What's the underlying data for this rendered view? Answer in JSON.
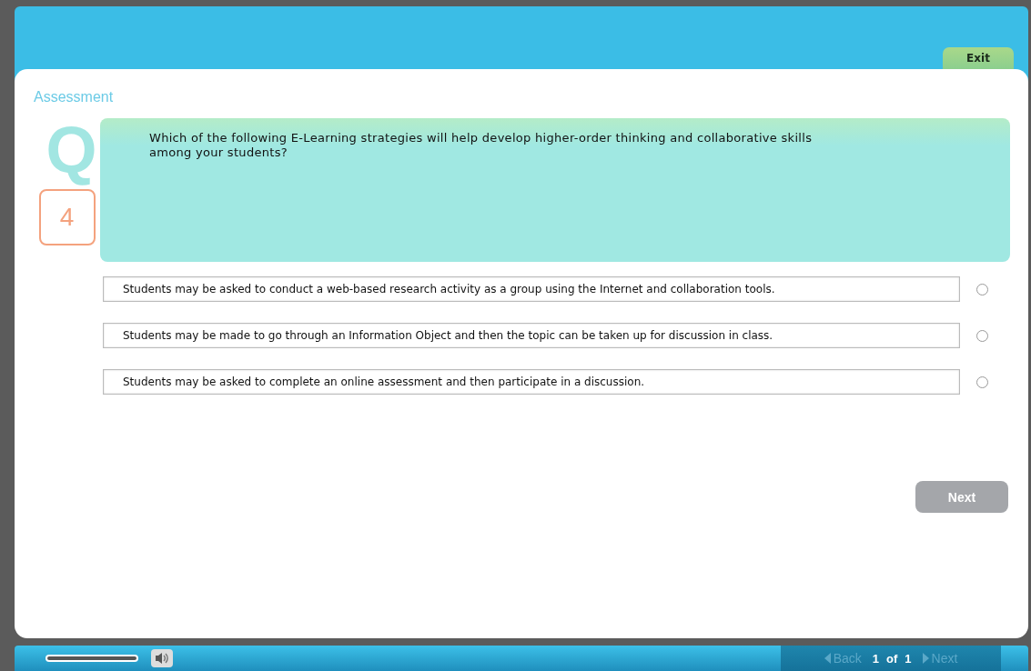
{
  "header": {
    "exit_button": "Exit"
  },
  "section_title": "Assessment",
  "question": {
    "letter": "Q",
    "number": "4",
    "text": "Which of the following E-Learning strategies will help develop higher-order thinking and collaborative skills among your students?"
  },
  "options": [
    {
      "text": "Students may be asked to conduct a web-based research activity as a group using the Internet and collaboration tools.",
      "selected": false
    },
    {
      "text": "Students may be made to go through an Information Object and then the topic can be taken up for discussion in class.",
      "selected": false
    },
    {
      "text": "Students may be asked to complete an online assessment and then participate in a discussion.",
      "selected": false
    }
  ],
  "next_button": {
    "label": "Next",
    "disabled": true
  },
  "footer": {
    "progress": {
      "level": 1
    },
    "back": {
      "label": "Back",
      "disabled": true
    },
    "page": "1",
    "of": "of",
    "total": "1",
    "next": {
      "label": "Next",
      "disabled": true
    }
  }
}
